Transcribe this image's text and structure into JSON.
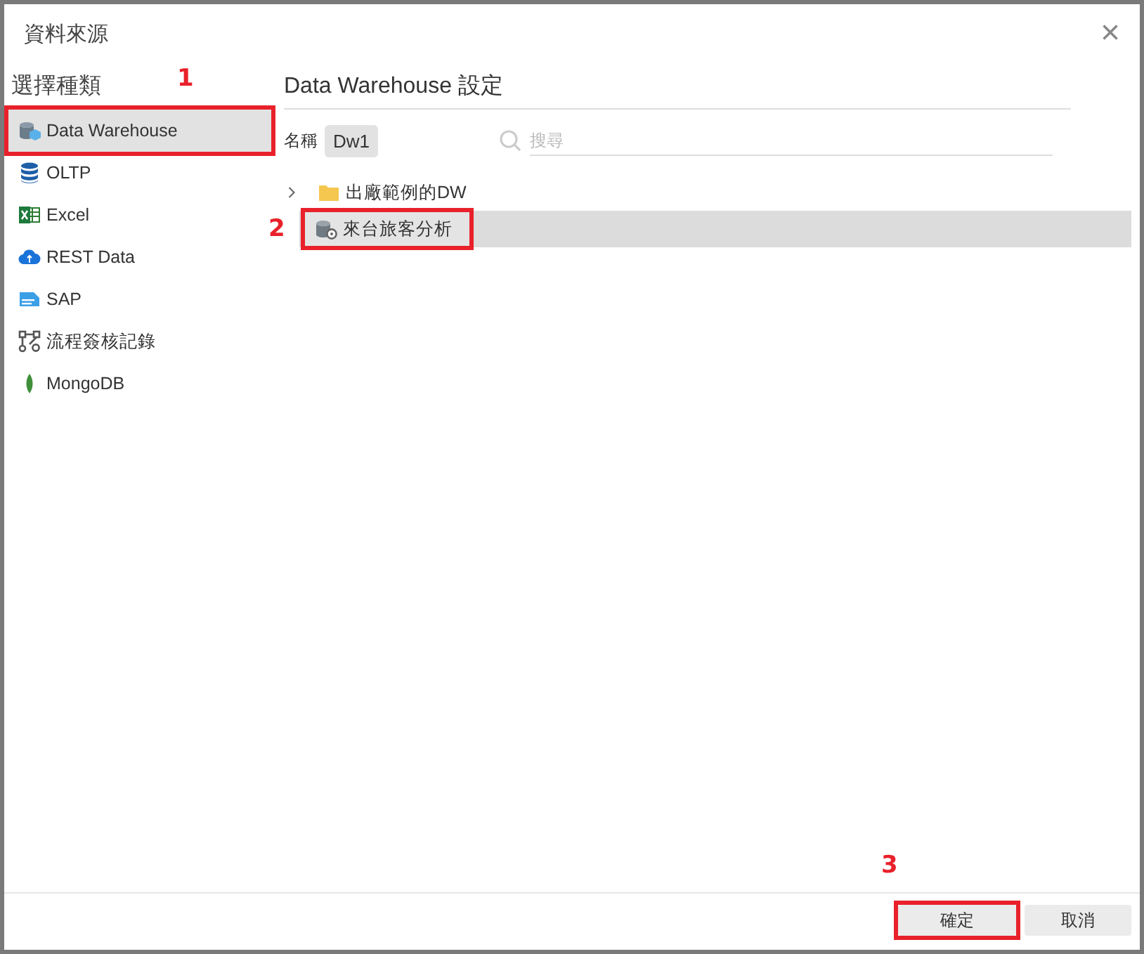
{
  "window": {
    "title": "資料來源",
    "close": "×"
  },
  "sidebar": {
    "heading": "選擇種類",
    "items": [
      {
        "label": "Data Warehouse",
        "kind": "warehouse",
        "selected": true,
        "callout": "1"
      },
      {
        "label": "OLTP",
        "kind": "database",
        "selected": false
      },
      {
        "label": "Excel",
        "kind": "excel",
        "selected": false
      },
      {
        "label": "REST Data",
        "kind": "cloud",
        "selected": false
      },
      {
        "label": "SAP",
        "kind": "sap",
        "selected": false
      },
      {
        "label": "流程簽核記錄",
        "kind": "flow",
        "selected": false
      },
      {
        "label": "MongoDB",
        "kind": "leaf",
        "selected": false
      }
    ]
  },
  "settings": {
    "heading": "Data Warehouse 設定",
    "name_label": "名稱",
    "name_value": "Dw1",
    "search": {
      "placeholder": "搜尋"
    },
    "tree": [
      {
        "label": "出廠範例的DW",
        "kind": "folder",
        "expanded": false,
        "selected": false
      },
      {
        "label": "來台旅客分析",
        "kind": "warehouse-item",
        "selected": true,
        "callout": "2"
      }
    ]
  },
  "buttons": [
    {
      "label": "確定",
      "callout": "3"
    },
    {
      "label": "取消"
    }
  ]
}
